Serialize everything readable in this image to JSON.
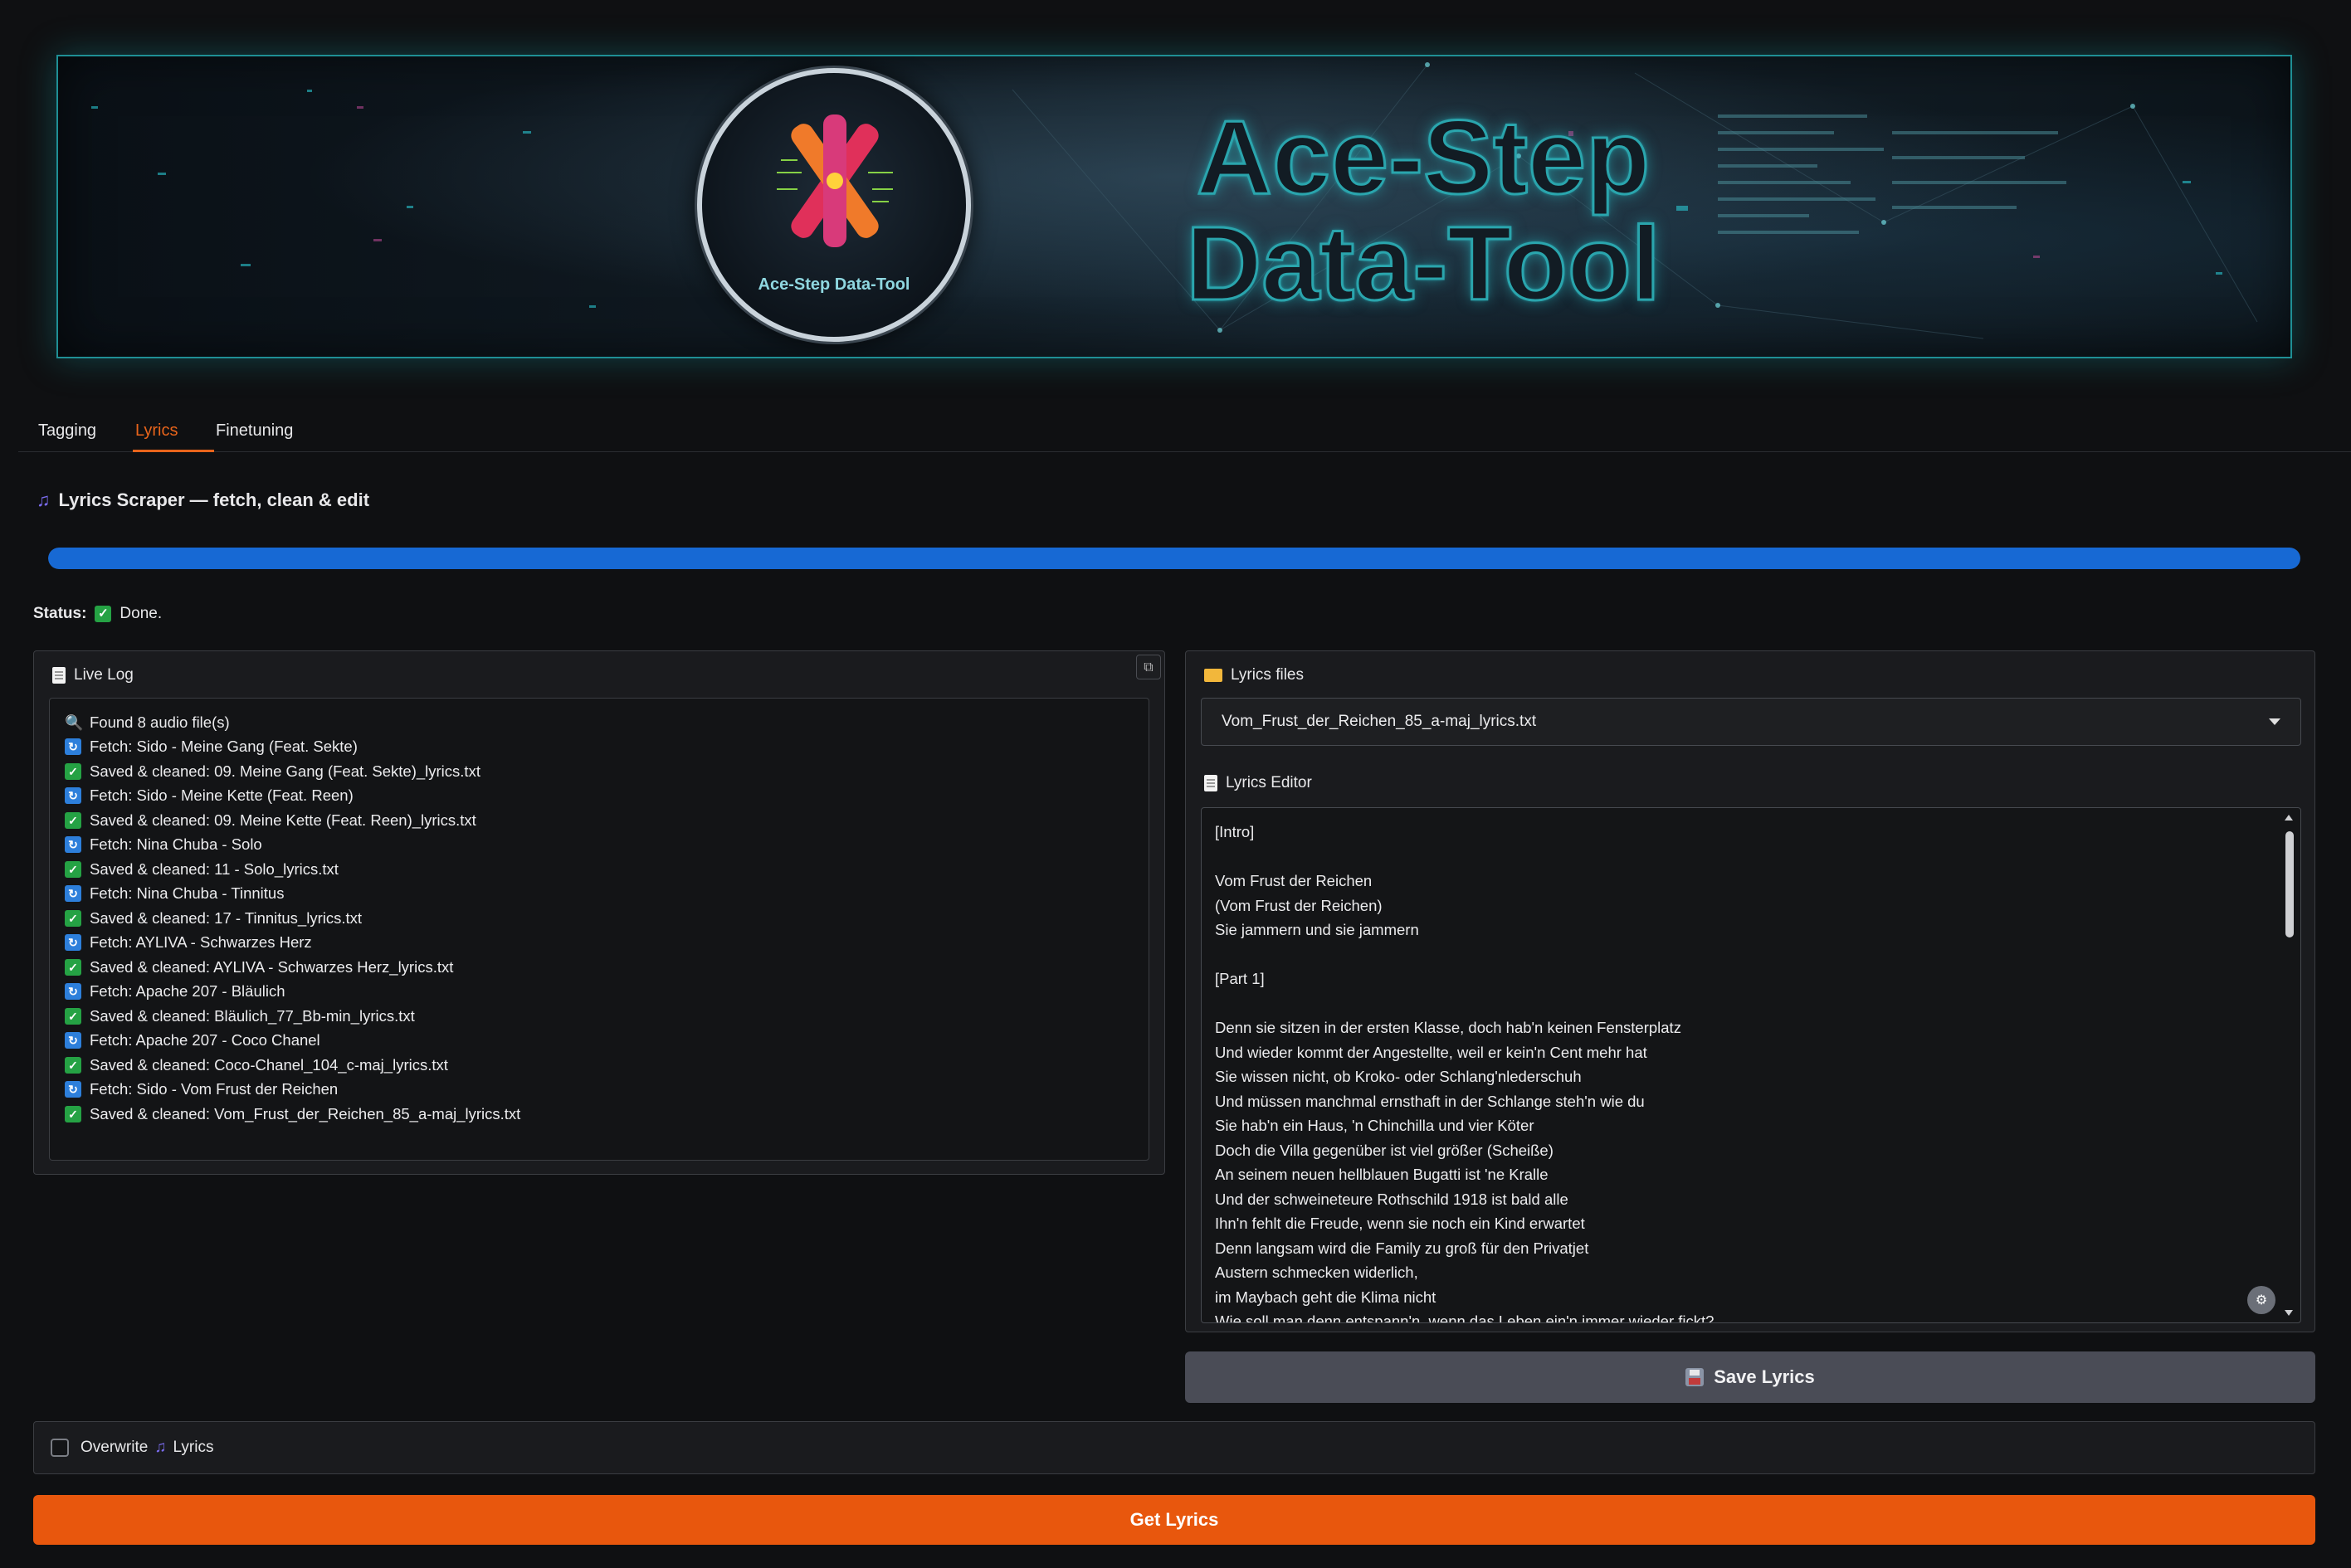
{
  "banner": {
    "title_line1": "Ace-Step",
    "title_line2": "Data-Tool",
    "logo_caption": "Ace-Step Data-Tool"
  },
  "tabs": [
    {
      "label": "Tagging",
      "active": false
    },
    {
      "label": "Lyrics",
      "active": true
    },
    {
      "label": "Finetuning",
      "active": false
    }
  ],
  "section_title": "Lyrics Scraper — fetch, clean & edit",
  "progress": {
    "fraction": 1.0,
    "color": "#1769d4"
  },
  "status": {
    "label": "Status:",
    "text": "Done."
  },
  "live_log": {
    "label": "Live Log",
    "lines": [
      {
        "icon": "search-icon",
        "text": "Found 8 audio file(s)"
      },
      {
        "icon": "refresh-icon",
        "text": "Fetch: Sido - Meine Gang (Feat. Sekte)"
      },
      {
        "icon": "check-icon",
        "text": "Saved & cleaned: 09. Meine Gang (Feat. Sekte)_lyrics.txt"
      },
      {
        "icon": "refresh-icon",
        "text": "Fetch: Sido - Meine Kette (Feat. Reen)"
      },
      {
        "icon": "check-icon",
        "text": "Saved & cleaned: 09. Meine Kette (Feat. Reen)_lyrics.txt"
      },
      {
        "icon": "refresh-icon",
        "text": "Fetch: Nina Chuba - Solo"
      },
      {
        "icon": "check-icon",
        "text": "Saved & cleaned: 11 - Solo_lyrics.txt"
      },
      {
        "icon": "refresh-icon",
        "text": "Fetch: Nina Chuba - Tinnitus"
      },
      {
        "icon": "check-icon",
        "text": "Saved & cleaned: 17 - Tinnitus_lyrics.txt"
      },
      {
        "icon": "refresh-icon",
        "text": "Fetch: AYLIVA - Schwarzes Herz"
      },
      {
        "icon": "check-icon",
        "text": "Saved & cleaned: AYLIVA - Schwarzes Herz_lyrics.txt"
      },
      {
        "icon": "refresh-icon",
        "text": "Fetch: Apache 207 - Bläulich"
      },
      {
        "icon": "check-icon",
        "text": "Saved & cleaned: Bläulich_77_Bb-min_lyrics.txt"
      },
      {
        "icon": "refresh-icon",
        "text": "Fetch: Apache 207 - Coco Chanel"
      },
      {
        "icon": "check-icon",
        "text": "Saved & cleaned: Coco-Chanel_104_c-maj_lyrics.txt"
      },
      {
        "icon": "refresh-icon",
        "text": "Fetch: Sido - Vom Frust der Reichen"
      },
      {
        "icon": "check-icon",
        "text": "Saved & cleaned: Vom_Frust_der_Reichen_85_a-maj_lyrics.txt"
      }
    ]
  },
  "lyrics_files": {
    "label": "Lyrics files",
    "selected": "Vom_Frust_der_Reichen_85_a-maj_lyrics.txt"
  },
  "lyrics_editor": {
    "label": "Lyrics Editor",
    "lines": [
      "[Intro]",
      "",
      "Vom Frust der Reichen",
      "(Vom Frust der Reichen)",
      "Sie jammern und sie jammern",
      "",
      "[Part 1]",
      "",
      "Denn sie sitzen in der ersten Klasse, doch hab'n keinen Fensterplatz",
      "Und wieder kommt der Angestellte, weil er kein'n Cent mehr hat",
      "Sie wissen nicht, ob Kroko- oder Schlang'nlederschuh",
      "Und müssen manchmal ernsthaft in der Schlange steh'n wie du",
      "Sie hab'n ein Haus, 'n Chinchilla und vier Köter",
      "Doch die Villa gegenüber ist viel größer (Scheiße)",
      "An seinem neuen hellblauen Bugatti ist 'ne Kralle",
      "Und der schweineteure Rothschild 1918 ist bald alle",
      "Ihn'n fehlt die Freude, wenn sie noch ein Kind erwartet",
      "Denn langsam wird die Family zu groß für den Privatjet",
      "Austern schmecken widerlich,",
      "im Maybach geht die Klima nicht",
      "Wie soll man denn entspann'n, wenn das Leben ein'n immer wieder fickt?"
    ]
  },
  "save_button": "Save Lyrics",
  "overwrite": {
    "label_pre": "Overwrite",
    "label_post": "Lyrics",
    "checked": false
  },
  "get_button": "Get Lyrics",
  "colors": {
    "accent": "#e8570d",
    "progress": "#1769d4",
    "success": "#25a244"
  }
}
